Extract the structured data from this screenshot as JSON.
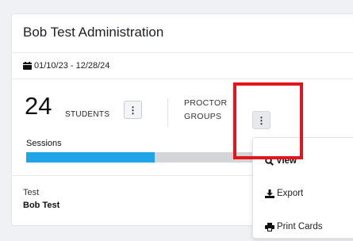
{
  "card": {
    "title": "Bob Test Administration",
    "date_range": "01/10/23 - 12/28/24"
  },
  "stats": {
    "student_count": "24",
    "students_label": "STUDENTS",
    "proctor_line1": "PROCTOR",
    "proctor_line2": "GROUPS"
  },
  "sessions": {
    "label": "Sessions",
    "progress_fraction": 0.56
  },
  "test": {
    "label": "Test",
    "name": "Bob Test"
  },
  "menu": {
    "items": [
      {
        "label": "View",
        "icon": "search-icon"
      },
      {
        "label": "Export",
        "icon": "download-icon"
      },
      {
        "label": "Print Cards",
        "icon": "printer-icon"
      }
    ]
  },
  "colors": {
    "progress": "#1ea4e7",
    "highlight": "#e3141c"
  }
}
